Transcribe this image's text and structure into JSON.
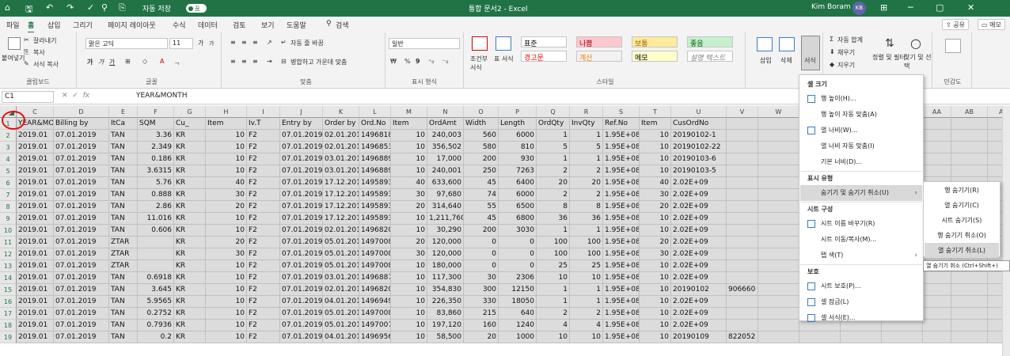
{
  "title_bar": {
    "quick_access": [
      "⌂",
      "🖫",
      "↶",
      "↷",
      "✓",
      "⚲",
      "⎘"
    ],
    "autosave_label": "자동 저장",
    "autosave_state": "끔",
    "title": "통합 문서2 - Excel",
    "user": "Kim Boram",
    "user_initials": "KB",
    "win_buttons": [
      "⊞",
      "─",
      "▢",
      "✕"
    ]
  },
  "menubar": {
    "tabs": [
      "파일",
      "홈",
      "삽입",
      "그리기",
      "페이지 레이아웃",
      "수식",
      "데이터",
      "검토",
      "보기",
      "도움말",
      "검색"
    ],
    "search_icon": "search-icon",
    "share": "공유",
    "comments": "메모"
  },
  "ribbon": {
    "clipboard": {
      "paste": "붙여넣기",
      "cut": "잘라내기",
      "copy": "복사",
      "format_painter": "서식 복사",
      "label": "클립보드"
    },
    "font": {
      "name": "맑은 고딕",
      "size": "11",
      "grow": "가",
      "shrink": "가",
      "bold": "가",
      "italic": "가",
      "underline": "가",
      "label": "글꼴"
    },
    "align": {
      "wrap": "자동 줄 바꿈",
      "merge": "병합하고 가운데 맞춤",
      "label": "맞춤"
    },
    "number": {
      "format": "일반",
      "percent": "%",
      "comma": "9",
      "label": "표시 형식"
    },
    "styles": {
      "conditional": "조건부 서식",
      "table": "표 서식",
      "cells": [
        {
          "text": "표준",
          "bg": "#ffffff",
          "fg": "#000000"
        },
        {
          "text": "나쁨",
          "bg": "#ffc7ce",
          "fg": "#9c0006"
        },
        {
          "text": "보통",
          "bg": "#ffeb9c",
          "fg": "#9c5700"
        },
        {
          "text": "좋음",
          "bg": "#c6efce",
          "fg": "#006100"
        },
        {
          "text": "경고문",
          "bg": "#ffffff",
          "fg": "#ff0000"
        },
        {
          "text": "계산",
          "bg": "#f2f2f2",
          "fg": "#fa7d00"
        },
        {
          "text": "메모",
          "bg": "#ffffcc",
          "fg": "#000000"
        },
        {
          "text": "설명 텍스트",
          "bg": "#ffffff",
          "fg": "#7f7f7f"
        }
      ],
      "label": "스타일"
    },
    "cells": {
      "insert": "삽입",
      "delete": "삭제",
      "format": "서식",
      "label": "셀"
    },
    "editing": {
      "autosum": "자동 합계",
      "fill": "채우기",
      "clear": "지우기",
      "sort": "정렬 및 필터",
      "find": "찾기 및 선택"
    },
    "sensitivity": {
      "label": "민감도"
    }
  },
  "formula_bar": {
    "name_box": "C1",
    "fx": "fx",
    "value": "YEAR&MONTH"
  },
  "columns": [
    "C",
    "D",
    "E",
    "F",
    "G",
    "H",
    "I",
    "J",
    "K",
    "L",
    "M",
    "N",
    "O",
    "P",
    "Q",
    "R",
    "S",
    "T",
    "U",
    "V",
    "W",
    "X",
    "Y",
    "Z",
    "AA",
    "AB",
    "AC"
  ],
  "rows": [
    {
      "n": "1",
      "cells": [
        "YEAR&MO",
        "Billing by",
        "ItCa",
        "SQM",
        "Cu_",
        "Item",
        "Iv.T",
        "Entry by",
        "Order by",
        "Ord.No",
        "Item",
        "OrdAmt",
        "Width",
        "Length",
        "OrdQty",
        "InvQty",
        "Ref.No",
        "Item",
        "CusOrdNo",
        ""
      ]
    },
    {
      "n": "2",
      "cells": [
        "2019.01",
        "07.01.2019",
        "TAN",
        "3.36",
        "KR",
        "10",
        "F2",
        "07.01.2019",
        "02.01.2019",
        "14968189",
        "10",
        "240,003",
        "560",
        "6000",
        "1",
        "1",
        "1.95E+08",
        "10",
        "20190102-1",
        ""
      ]
    },
    {
      "n": "3",
      "cells": [
        "2019.01",
        "07.01.2019",
        "TAN",
        "2.349",
        "KR",
        "10",
        "F2",
        "07.01.2019",
        "02.01.2019",
        "14968531",
        "10",
        "356,502",
        "580",
        "810",
        "5",
        "5",
        "1.95E+08",
        "10",
        "20190102-22",
        ""
      ]
    },
    {
      "n": "4",
      "cells": [
        "2019.01",
        "07.01.2019",
        "TAN",
        "0.186",
        "KR",
        "10",
        "F2",
        "07.01.2019",
        "03.01.2019",
        "14968892",
        "10",
        "17,000",
        "200",
        "930",
        "1",
        "1",
        "1.95E+08",
        "10",
        "20190103-6",
        ""
      ]
    },
    {
      "n": "5",
      "cells": [
        "2019.01",
        "07.01.2019",
        "TAN",
        "3.6315",
        "KR",
        "10",
        "F2",
        "07.01.2019",
        "03.01.2019",
        "14968893",
        "10",
        "240,001",
        "250",
        "7263",
        "2",
        "2",
        "1.95E+08",
        "10",
        "20190103-5",
        ""
      ]
    },
    {
      "n": "6",
      "cells": [
        "2019.01",
        "07.01.2019",
        "TAN",
        "5.76",
        "KR",
        "40",
        "F2",
        "07.01.2019",
        "17.12.2018",
        "14958937",
        "40",
        "633,600",
        "45",
        "6400",
        "20",
        "20",
        "1.95E+08",
        "40",
        "2.02E+09",
        ""
      ]
    },
    {
      "n": "7",
      "cells": [
        "2019.01",
        "07.01.2019",
        "TAN",
        "0.888",
        "KR",
        "30",
        "F2",
        "07.01.2019",
        "17.12.2018",
        "14958937",
        "30",
        "97,680",
        "74",
        "6000",
        "2",
        "2",
        "1.95E+08",
        "30",
        "2.02E+09",
        ""
      ]
    },
    {
      "n": "8",
      "cells": [
        "2019.01",
        "07.01.2019",
        "TAN",
        "2.86",
        "KR",
        "20",
        "F2",
        "07.01.2019",
        "17.12.2018",
        "14958937",
        "20",
        "314,640",
        "55",
        "6500",
        "8",
        "8",
        "1.95E+08",
        "20",
        "2.02E+09",
        ""
      ]
    },
    {
      "n": "9",
      "cells": [
        "2019.01",
        "07.01.2019",
        "TAN",
        "11.016",
        "KR",
        "10",
        "F2",
        "07.01.2019",
        "17.12.2018",
        "14958937",
        "10",
        "1,211,760",
        "45",
        "6800",
        "36",
        "36",
        "1.95E+08",
        "10",
        "2.02E+09",
        ""
      ]
    },
    {
      "n": "10",
      "cells": [
        "2019.01",
        "07.01.2019",
        "TAN",
        "0.606",
        "KR",
        "10",
        "F2",
        "07.01.2019",
        "02.01.2019",
        "14968208",
        "10",
        "30,290",
        "200",
        "3030",
        "1",
        "1",
        "1.95E+08",
        "10",
        "2.02E+09",
        ""
      ]
    },
    {
      "n": "11",
      "cells": [
        "2019.01",
        "07.01.2019",
        "ZTAR",
        "",
        "KR",
        "20",
        "F2",
        "07.01.2019",
        "05.01.2019",
        "14970080",
        "20",
        "120,000",
        "0",
        "0",
        "100",
        "100",
        "1.95E+08",
        "20",
        "2.02E+09",
        ""
      ]
    },
    {
      "n": "12",
      "cells": [
        "2019.01",
        "07.01.2019",
        "ZTAR",
        "",
        "KR",
        "30",
        "F2",
        "07.01.2019",
        "05.01.2019",
        "14970080",
        "30",
        "120,000",
        "0",
        "0",
        "100",
        "100",
        "1.95E+08",
        "30",
        "2.02E+09",
        ""
      ]
    },
    {
      "n": "13",
      "cells": [
        "2019.01",
        "07.01.2019",
        "ZTAR",
        "",
        "KR",
        "10",
        "F2",
        "07.01.2019",
        "05.01.2019",
        "14970080",
        "10",
        "180,000",
        "0",
        "0",
        "25",
        "25",
        "1.95E+08",
        "10",
        "2.02E+09",
        ""
      ]
    },
    {
      "n": "14",
      "cells": [
        "2019.01",
        "07.01.2019",
        "TAN",
        "0.6918",
        "KR",
        "10",
        "F2",
        "07.01.2019",
        "03.01.2019",
        "14968873",
        "10",
        "117,300",
        "30",
        "2306",
        "10",
        "10",
        "1.95E+08",
        "10",
        "2.02E+09",
        ""
      ]
    },
    {
      "n": "15",
      "cells": [
        "2019.01",
        "07.01.2019",
        "TAN",
        "3.645",
        "KR",
        "10",
        "F2",
        "07.01.2019",
        "02.01.2019",
        "14968206",
        "10",
        "354,830",
        "300",
        "12150",
        "1",
        "1",
        "1.95E+08",
        "10",
        "20190102",
        "906660"
      ]
    },
    {
      "n": "16",
      "cells": [
        "2019.01",
        "07.01.2019",
        "TAN",
        "5.9565",
        "KR",
        "10",
        "F2",
        "07.01.2019",
        "04.01.2019",
        "14969496",
        "10",
        "226,350",
        "330",
        "18050",
        "1",
        "1",
        "1.95E+08",
        "10",
        "2.02E+09",
        ""
      ]
    },
    {
      "n": "17",
      "cells": [
        "2019.01",
        "07.01.2019",
        "TAN",
        "0.2752",
        "KR",
        "10",
        "F2",
        "07.01.2019",
        "05.01.2019",
        "14970081",
        "10",
        "83,860",
        "215",
        "640",
        "2",
        "2",
        "1.95E+08",
        "10",
        "2.02E+09",
        ""
      ]
    },
    {
      "n": "18",
      "cells": [
        "2019.01",
        "07.01.2019",
        "TAN",
        "0.7936",
        "KR",
        "10",
        "F2",
        "07.01.2019",
        "05.01.2019",
        "14970079",
        "10",
        "197,120",
        "160",
        "1240",
        "4",
        "4",
        "1.95E+08",
        "10",
        "2.02E+09",
        ""
      ]
    },
    {
      "n": "19",
      "cells": [
        "2019.01",
        "07.01.2019",
        "TAN",
        "0.2",
        "KR",
        "10",
        "F2",
        "07.01.2019",
        "04.01.2019",
        "14969561",
        "10",
        "58,500",
        "20",
        "1000",
        "10",
        "10",
        "1.95E+08",
        "10",
        "20190109",
        "822052"
      ]
    }
  ],
  "context_menu": {
    "sections": [
      {
        "header": "셀 크기",
        "items": [
          {
            "label": "행 높이(H)...",
            "icon": "row-height-icon"
          },
          {
            "label": "행 높이 자동 맞춤(A)"
          },
          {
            "label": "열 너비(W)...",
            "icon": "column-width-icon"
          },
          {
            "label": "열 너비 자동 맞춤(I)"
          },
          {
            "label": "기본 너비(D)..."
          }
        ]
      },
      {
        "header": "표시 유형",
        "items": [
          {
            "label": "숨기기 및 숨기기 취소(U)",
            "submenu": true,
            "highlight": true
          }
        ]
      },
      {
        "header": "시트 구성",
        "items": [
          {
            "label": "시트 이름 바꾸기(R)",
            "icon": "rename-icon"
          },
          {
            "label": "시트 이동/복사(M)..."
          },
          {
            "label": "탭 색(T)",
            "submenu": true
          }
        ]
      },
      {
        "header": "보호",
        "items": [
          {
            "label": "시트 보호(P)...",
            "icon": "protect-sheet-icon"
          },
          {
            "label": "셀 잠금(L)",
            "icon": "lock-icon"
          },
          {
            "label": "셀 서식(E)...",
            "icon": "format-cells-icon"
          }
        ]
      }
    ]
  },
  "submenu": {
    "items": [
      "행 숨기기(R)",
      "열 숨기기(C)",
      "시트 숨기기(S)",
      "행 숨기기 취소(O)",
      "열 숨기기 취소(L)"
    ],
    "highlight_index": 4
  },
  "tooltip": "열 숨기기 취소 (Ctrl+Shift+)"
}
